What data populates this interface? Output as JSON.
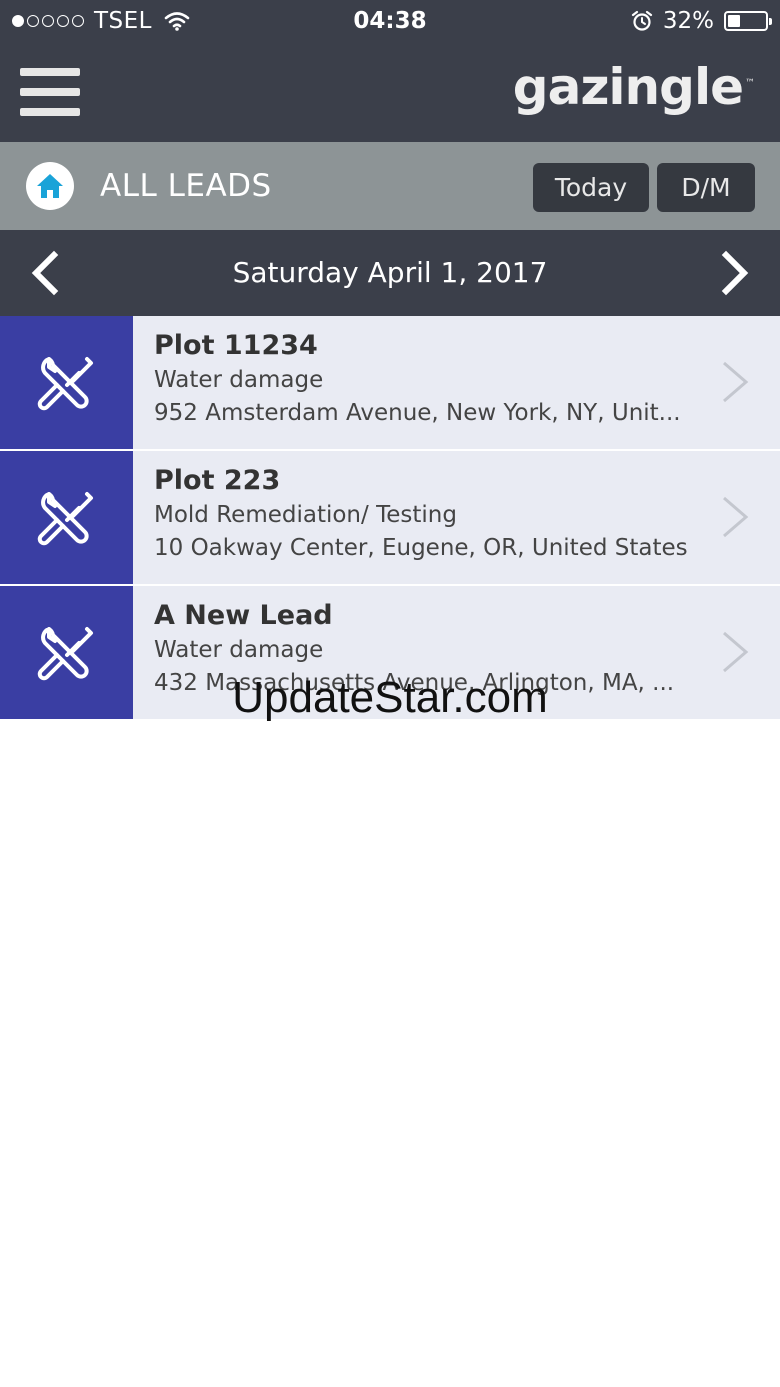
{
  "status_bar": {
    "carrier": "TSEL",
    "time": "04:38",
    "battery_percent": "32%",
    "battery_level": 0.32,
    "signal_bars_filled": 1,
    "signal_bars_total": 5
  },
  "app_bar": {
    "logo": "gazingle",
    "logo_mark": "™"
  },
  "leads_bar": {
    "title": "ALL LEADS",
    "today_label": "Today",
    "dm_label": "D/M"
  },
  "date_nav": {
    "date": "Saturday April 1, 2017"
  },
  "leads": [
    {
      "title": "Plot 11234",
      "type": "Water damage",
      "address": "952 Amsterdam Avenue, New York, NY, Unit..."
    },
    {
      "title": "Plot 223",
      "type": "Mold Remediation/ Testing",
      "address": "10 Oakway Center, Eugene, OR, United States"
    },
    {
      "title": "A New Lead",
      "type": "Water damage",
      "address": "432 Massachusetts Avenue, Arlington, MA, ..."
    }
  ],
  "watermark": "UpdateStar.com",
  "colors": {
    "header_bg": "#3b3f4a",
    "leads_bar_bg": "#8d9496",
    "icon_box_bg": "#3a3ea3",
    "row_bg": "#e9ebf3",
    "home_icon": "#1aa3d8"
  }
}
